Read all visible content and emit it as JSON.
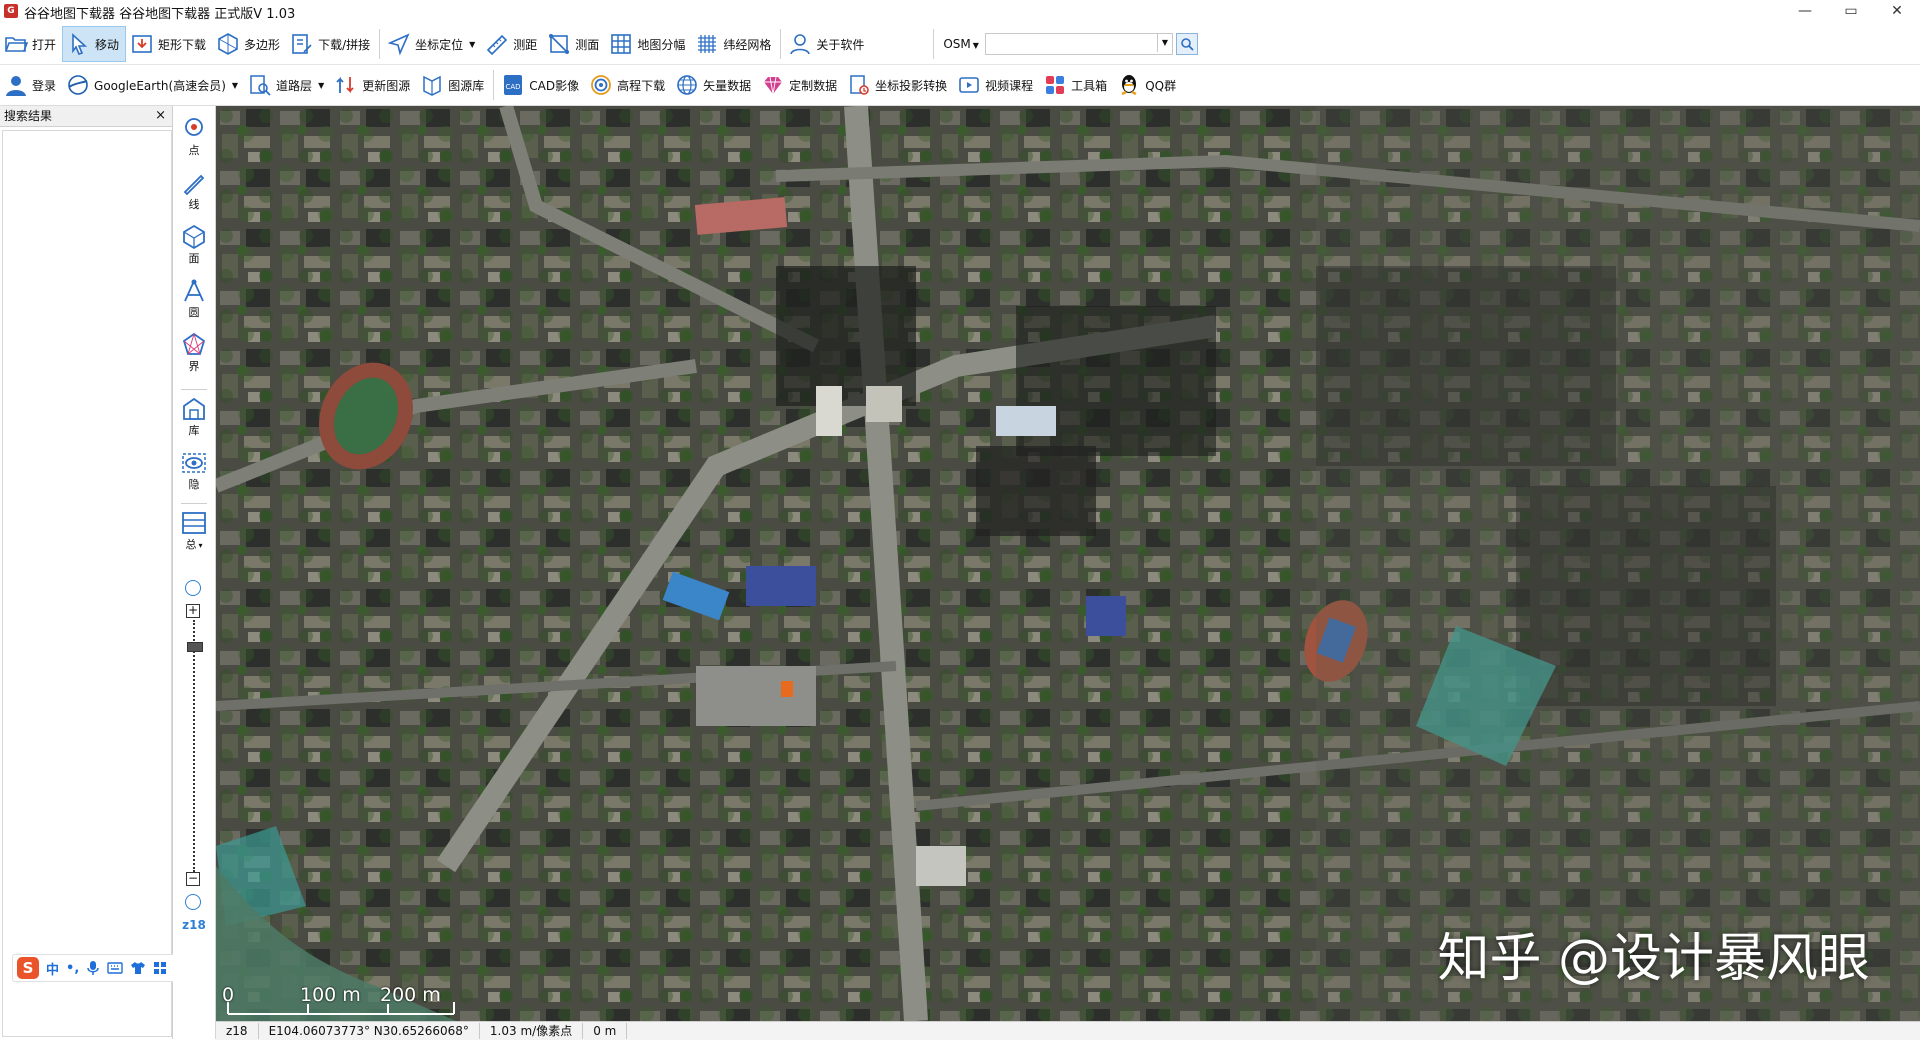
{
  "window": {
    "title": "谷谷地图下载器  谷谷地图下载器 正式版V 1.03",
    "app_icon_text": "G",
    "controls": [
      "—",
      "▭",
      "✕"
    ]
  },
  "toolbar1": {
    "items": [
      {
        "label": "打开",
        "icon": "folder-open-icon"
      },
      {
        "label": "移动",
        "icon": "pointer-icon",
        "active": true
      },
      {
        "label": "矩形下载",
        "icon": "rect-download-icon"
      },
      {
        "label": "多边形",
        "icon": "polygon-icon"
      },
      {
        "label": "下载/拼接",
        "icon": "stitch-icon"
      },
      {
        "label": "坐标定位",
        "icon": "locate-icon",
        "dropdown": true
      },
      {
        "label": "测距",
        "icon": "ruler-icon"
      },
      {
        "label": "测面",
        "icon": "measure-area-icon"
      },
      {
        "label": "地图分幅",
        "icon": "grid-icon"
      },
      {
        "label": "纬经网格",
        "icon": "lat-lon-grid-icon"
      },
      {
        "label": "关于软件",
        "icon": "user-icon"
      }
    ],
    "source_label": "OSM",
    "source_select_value": ""
  },
  "toolbar2": {
    "items": [
      {
        "label": "登录",
        "icon": "login-icon"
      },
      {
        "label": "GoogleEarth(高速会员)",
        "icon": "google-earth-icon",
        "dropdown": true
      },
      {
        "label": "道路层",
        "icon": "road-layer-icon",
        "dropdown": true
      },
      {
        "label": "更新图源",
        "icon": "update-source-icon"
      },
      {
        "label": "图源库",
        "icon": "source-library-icon"
      },
      {
        "label": "CAD影像",
        "icon": "cad-icon"
      },
      {
        "label": "高程下载",
        "icon": "elevation-icon"
      },
      {
        "label": "矢量数据",
        "icon": "vector-globe-icon"
      },
      {
        "label": "定制数据",
        "icon": "diamond-icon"
      },
      {
        "label": "坐标投影转换",
        "icon": "projection-icon"
      },
      {
        "label": "视频课程",
        "icon": "video-icon"
      },
      {
        "label": "工具箱",
        "icon": "toolbox-icon"
      },
      {
        "label": "QQ群",
        "icon": "qq-icon"
      }
    ]
  },
  "left_panel": {
    "title": "搜索结果",
    "close": "×"
  },
  "ime": {
    "logo": "S",
    "mode": "中",
    "punct": "•,"
  },
  "vertical_toolbar": {
    "items": [
      {
        "label": "点",
        "icon": "point-icon"
      },
      {
        "label": "线",
        "icon": "line-icon"
      },
      {
        "label": "面",
        "icon": "area-icon"
      },
      {
        "label": "圆",
        "icon": "circle-icon"
      },
      {
        "label": "界",
        "icon": "boundary-icon"
      },
      {
        "label": "库",
        "icon": "library-icon"
      },
      {
        "label": "隐",
        "icon": "hide-icon"
      },
      {
        "label": "总",
        "icon": "layers-icon",
        "dropdown": true
      }
    ],
    "zoom_level": "z18"
  },
  "map": {
    "scale_labels": [
      "0",
      "100 m",
      "200 m"
    ],
    "watermark": "知乎 @设计暴风眼"
  },
  "statusbar": {
    "zoom": "z18",
    "coordinates": "E104.06073773° N30.65266068°",
    "resolution": "1.03 m/像素点",
    "elevation": "0 m"
  }
}
